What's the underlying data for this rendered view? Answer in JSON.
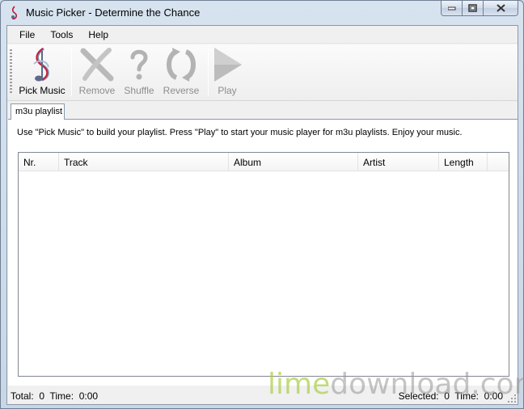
{
  "window": {
    "title": "Music Picker - Determine the Chance"
  },
  "menubar": {
    "items": [
      "File",
      "Tools",
      "Help"
    ]
  },
  "toolbar": {
    "buttons": [
      {
        "label": "Pick Music",
        "icon": "music-note-icon",
        "enabled": true
      },
      {
        "label": "Remove",
        "icon": "remove-x-icon",
        "enabled": false
      },
      {
        "label": "Shuffle",
        "icon": "question-mark-icon",
        "enabled": false
      },
      {
        "label": "Reverse",
        "icon": "reverse-arrows-icon",
        "enabled": false
      },
      {
        "label": "Play",
        "icon": "play-icon",
        "enabled": false
      }
    ]
  },
  "tabs": [
    {
      "label": "m3u playlist",
      "active": true
    }
  ],
  "playlist": {
    "info": "Use \"Pick Music\" to build your playlist. Press \"Play\" to start your music player for m3u playlists. Enjoy your music.",
    "columns": [
      "Nr.",
      "Track",
      "Album",
      "Artist",
      "Length"
    ],
    "rows": []
  },
  "status": {
    "left": "Total:  0  Time:  0:00",
    "right": "Selected:  0  Time:  0:00"
  },
  "watermark": {
    "part1": "lime",
    "part2": "download.com"
  },
  "colors": {
    "lime": "#aacd46",
    "disabled_text": "#8d8d8d",
    "frame": "#c8d6e6"
  }
}
